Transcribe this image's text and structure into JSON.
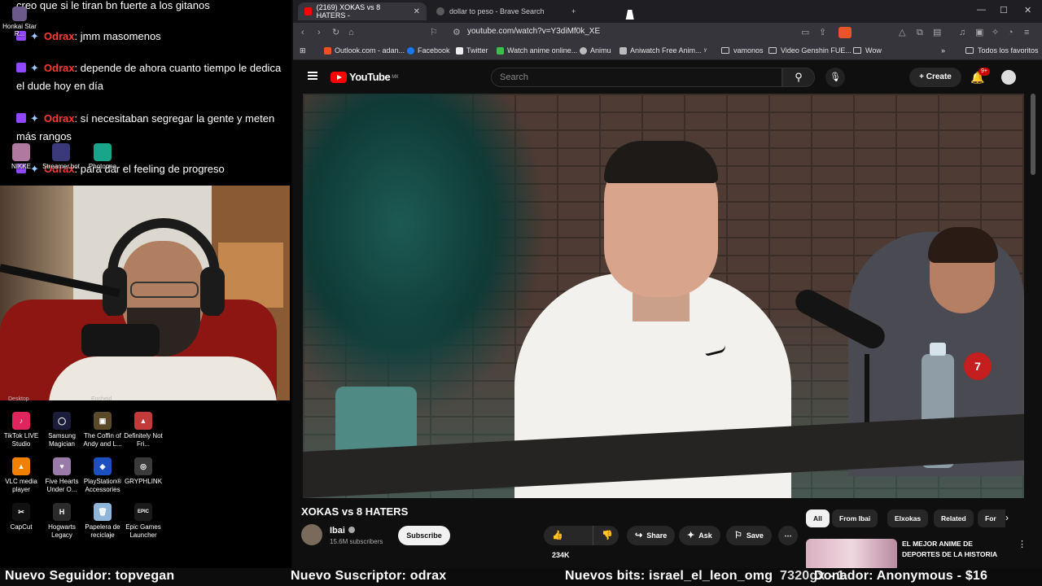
{
  "chat": {
    "lines": [
      {
        "text": "creo que si le tiran bn fuerte a los gitanos"
      },
      {
        "user": "Odrax",
        "text": ": jmm masomenos"
      },
      {
        "user": "Odrax",
        "text": ": depende de ahora cuanto tiempo le dedica el dude hoy en día"
      },
      {
        "user": "Odrax",
        "text": ": sí necesitaban segregar la gente y meten más rangos"
      },
      {
        "user": "Odrax",
        "text": ": para dar el feeling de progreso"
      }
    ]
  },
  "desktop_top": {
    "honkai": "Honkai Star R...",
    "nikke": "NIKKE",
    "streamerbot": "Streamer.bot",
    "photopea": "Photopea"
  },
  "webcam_cut_labels": [
    "Desktop",
    "Encheid"
  ],
  "desktop_icons": [
    {
      "label": "TikTok LIVE Studio",
      "color": "#e0245e",
      "glyph": "♪"
    },
    {
      "label": "Samsung Magician",
      "color": "#1b1b3a",
      "glyph": "◯"
    },
    {
      "label": "The Coffin of Andy and L...",
      "color": "#5a4a2a",
      "glyph": "▣"
    },
    {
      "label": "Definitely Not Fri...",
      "color": "#c23a3a",
      "glyph": "▲"
    },
    {
      "label": "VLC media player",
      "color": "#f08000",
      "glyph": "▲"
    },
    {
      "label": "Five Hearts Under O...",
      "color": "#9a7aa8",
      "glyph": "♥"
    },
    {
      "label": "PlayStation® Accessories",
      "color": "#1c4fbf",
      "glyph": "◈"
    },
    {
      "label": "GRYPHLINK",
      "color": "#3a3a3a",
      "glyph": "◎"
    },
    {
      "label": "CapCut",
      "color": "#111111",
      "glyph": "✂"
    },
    {
      "label": "Hogwarts Legacy",
      "color": "#2a2a2a",
      "glyph": "H"
    },
    {
      "label": "Papelera de reciclaje",
      "color": "#8fb6d8",
      "glyph": "🗑"
    },
    {
      "label": "Epic Games Launcher",
      "color": "#1a1a1a",
      "glyph": "EPIC"
    }
  ],
  "ticker": {
    "follower": "Nuevo Seguidor: topvegan",
    "sub": "Nuevo Suscriptor: odrax",
    "bits": "Nuevos bits: israel_el_leon_omg",
    "overlay": "7320gx - 1",
    "donation": "Donador: Anonymous - $16"
  },
  "browser": {
    "tabs": [
      {
        "label": "(2169) XOKAS vs 8 HATERS -",
        "active": true
      },
      {
        "label": "dollar to peso - Brave Search",
        "active": false
      }
    ],
    "new_tab": "+",
    "url": "youtube.com/watch?v=Y3diMf0k_XE",
    "bookmarks": [
      {
        "label": "Outlook.com - adan...",
        "color": "#f25022"
      },
      {
        "label": "Facebook",
        "color": "#1877f2"
      },
      {
        "label": "Twitter",
        "color": "#eeeeee"
      },
      {
        "label": "Watch anime online...",
        "color": "#3cc04a"
      },
      {
        "label": "Animu",
        "color": "#bbbbbb"
      },
      {
        "label": "Aniwatch Free Anim...",
        "color": "#bbbbbb"
      },
      {
        "label": "vamonos",
        "folder": true
      },
      {
        "label": "Video Genshin FUE...",
        "folder": true
      },
      {
        "label": "Wow",
        "folder": true
      }
    ],
    "all_bookmarks": "Todos los favoritos"
  },
  "youtube": {
    "logo": "YouTube",
    "region": "MX",
    "search_placeholder": "Search",
    "create": "Create",
    "notif_count": "9+",
    "video_title": "XOKAS vs 8 HATERS",
    "channel": "Ibai",
    "subscribers": "15.6M subscribers",
    "subscribe": "Subscribe",
    "likes": "234K",
    "share": "Share",
    "ask": "Ask",
    "save": "Save",
    "chips": [
      "All",
      "From Ibai",
      "Elxokas",
      "Related",
      "For yo"
    ],
    "rec_title": "EL MEJOR ANIME DE DEPORTES DE LA HISTORIA",
    "player_badge": "7"
  }
}
